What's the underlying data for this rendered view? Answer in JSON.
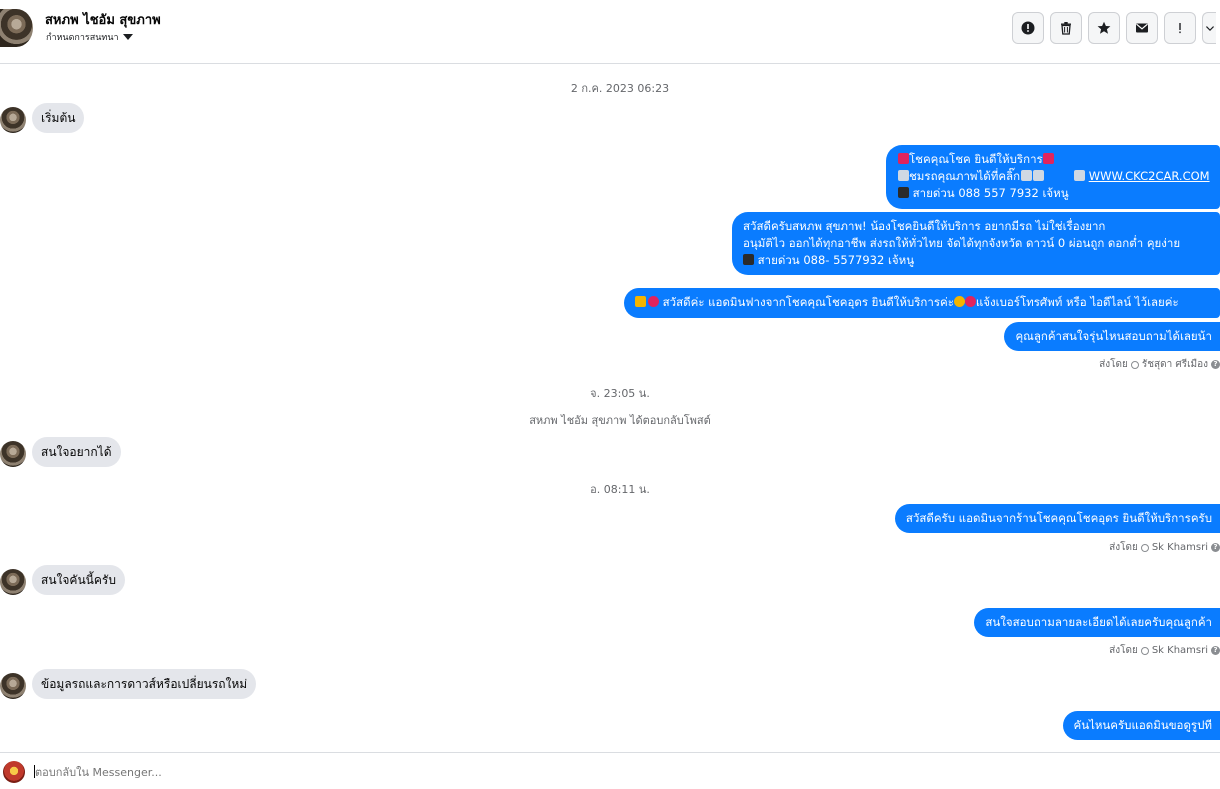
{
  "header": {
    "contact_name": "สหภพ ไชอัม สุขภาพ",
    "subtitle": "กำหนดการสนทนา",
    "toolbar": [
      {
        "icon": "report-icon",
        "symbol": "!"
      },
      {
        "icon": "trash-icon"
      },
      {
        "icon": "star-icon"
      },
      {
        "icon": "mail-icon"
      },
      {
        "icon": "exclamation-icon",
        "symbol": "!"
      },
      {
        "icon": "chevron-down-icon"
      }
    ]
  },
  "timestamps": {
    "t1": "2 ก.ค. 2023 06:23",
    "t2": "จ. 23:05 น.",
    "t3": "อ. 08:11 น."
  },
  "system_note": "สหภพ ไชอัม สุขภาพ ได้ตอบกลับโพสต์",
  "messages": {
    "m1": "เริ่มต้น",
    "m2_l1": "โชคคุณโชค ยินดีให้บริการ",
    "m2_l2a": "ชมรถคุณภาพได้ที่คลิ๊ก",
    "m2_link": "WWW.CKC2CAR.COM",
    "m2_l3": "สายด่วน 088 557 7932 เจ้หนู",
    "m3_l1": "สวัสดีครับสหภพ สุขภาพ! น้องโชคยินดีให้บริการ อยากมีรถ ไม่ใช่เรื่องยาก",
    "m3_l2": "อนุมัติไว ออกได้ทุกอาชีพ ส่งรถให้ทั่วไทย จัดได้ทุกจังหวัด ดาวน์ 0  ผ่อนถูก ดอกต่ำ คุยง่าย",
    "m3_l3": "สายด่วน 088- 5577932 เจ้หนู",
    "m4_a": "สวัสดีค่ะ แอดมินฟางจากโชคคุณโชคอุดร ยินดีให้บริการค่ะ",
    "m4_b": "แจ้งเบอร์โทรศัพท์ หรือ ไอดีไลน์  ไว้เลยค่ะ",
    "m5": "คุณลูกค้าสนใจรุ่นไหนสอบถามได้เลยน้า",
    "m6": "สนใจอยากได้",
    "m7": "สวัสดีครับ แอดมินจากร้านโชคคุณโชคอุดร ยินดีให้บริการครับ",
    "m8": "สนใจคันนี้ครับ",
    "m9": "สนใจสอบถามลายละเอียดได้เลยครับคุณลูกค้า",
    "m10": "ข้อมูลรถและการดาวส์หรือเปลี่ยนรถใหม่",
    "m11": "คันไหนครับแอดมินขอดูรูปที"
  },
  "sent_by": {
    "label": "ส่งโดย",
    "s1": "รัชสุดา ศรีเมือง",
    "s2": "Sk Khamsri",
    "s3": "Sk Khamsri"
  },
  "composer": {
    "placeholder": "ตอบกลับใน Messenger..."
  },
  "colors": {
    "outgoing_bubble": "#0a7cff",
    "incoming_bubble": "#e4e6eb"
  }
}
